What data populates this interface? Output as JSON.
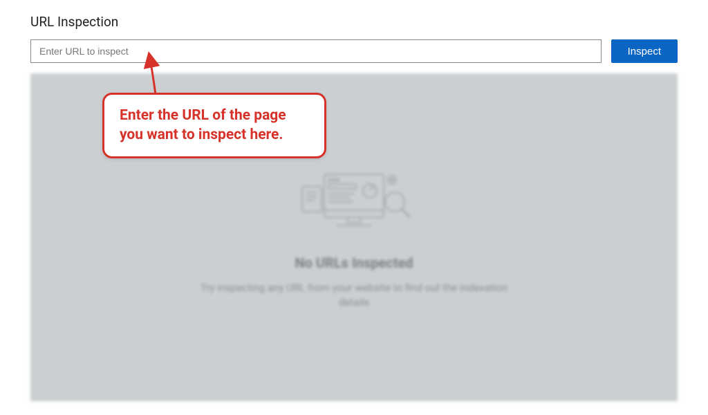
{
  "page": {
    "title": "URL Inspection"
  },
  "input": {
    "placeholder": "Enter URL to inspect",
    "value": ""
  },
  "buttons": {
    "inspect": "Inspect"
  },
  "empty_state": {
    "title": "No URLs Inspected",
    "description": "Try inspecting any URL from your website to find out the indexation details"
  },
  "annotation": {
    "callout_text": "Enter the URL of the page you want to inspect here.",
    "color": "#d6322a"
  }
}
